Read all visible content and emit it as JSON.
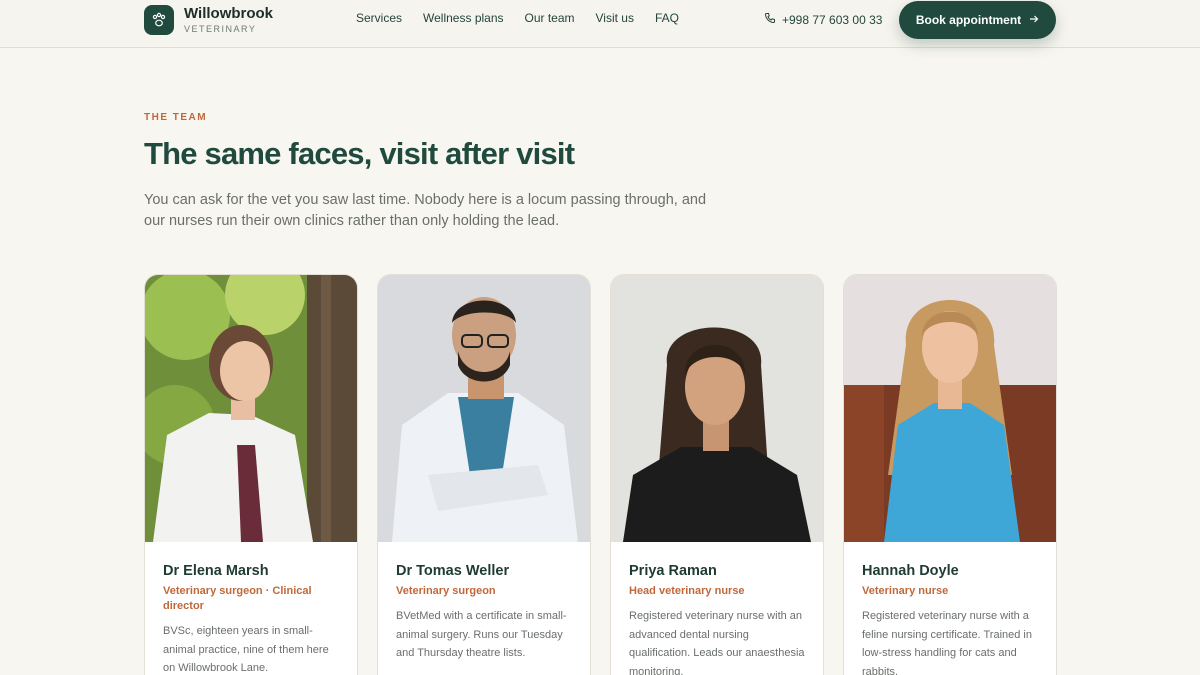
{
  "header": {
    "brand_name": "Willowbrook",
    "brand_sub": "VETERINARY",
    "nav": [
      "Services",
      "Wellness plans",
      "Our team",
      "Visit us",
      "FAQ"
    ],
    "phone": "+998 77 603 00 33",
    "book_label": "Book appointment"
  },
  "section": {
    "eyebrow": "THE TEAM",
    "title": "The same faces, visit after visit",
    "intro": "You can ask for the vet you saw last time. Nobody here is a locum passing through, and our nurses run their own clinics rather than only holding the lead."
  },
  "team": [
    {
      "name": "Dr Elena Marsh",
      "role": "Veterinary surgeon · Clinical director",
      "bio": "BVSc, eighteen years in small-animal practice, nine of them here on Willowbrook Lane."
    },
    {
      "name": "Dr Tomas Weller",
      "role": "Veterinary surgeon",
      "bio": "BVetMed with a certificate in small-animal surgery. Runs our Tuesday and Thursday theatre lists."
    },
    {
      "name": "Priya Raman",
      "role": "Head veterinary nurse",
      "bio": "Registered veterinary nurse with an advanced dental nursing qualification. Leads our anaesthesia monitoring."
    },
    {
      "name": "Hannah Doyle",
      "role": "Veterinary nurse",
      "bio": "Registered veterinary nurse with a feline nursing certificate. Trained in low-stress handling for cats and rabbits."
    }
  ],
  "colors": {
    "accent": "#1f4a3d",
    "eyebrow": "#c0683a",
    "background": "#f8f6f1"
  }
}
